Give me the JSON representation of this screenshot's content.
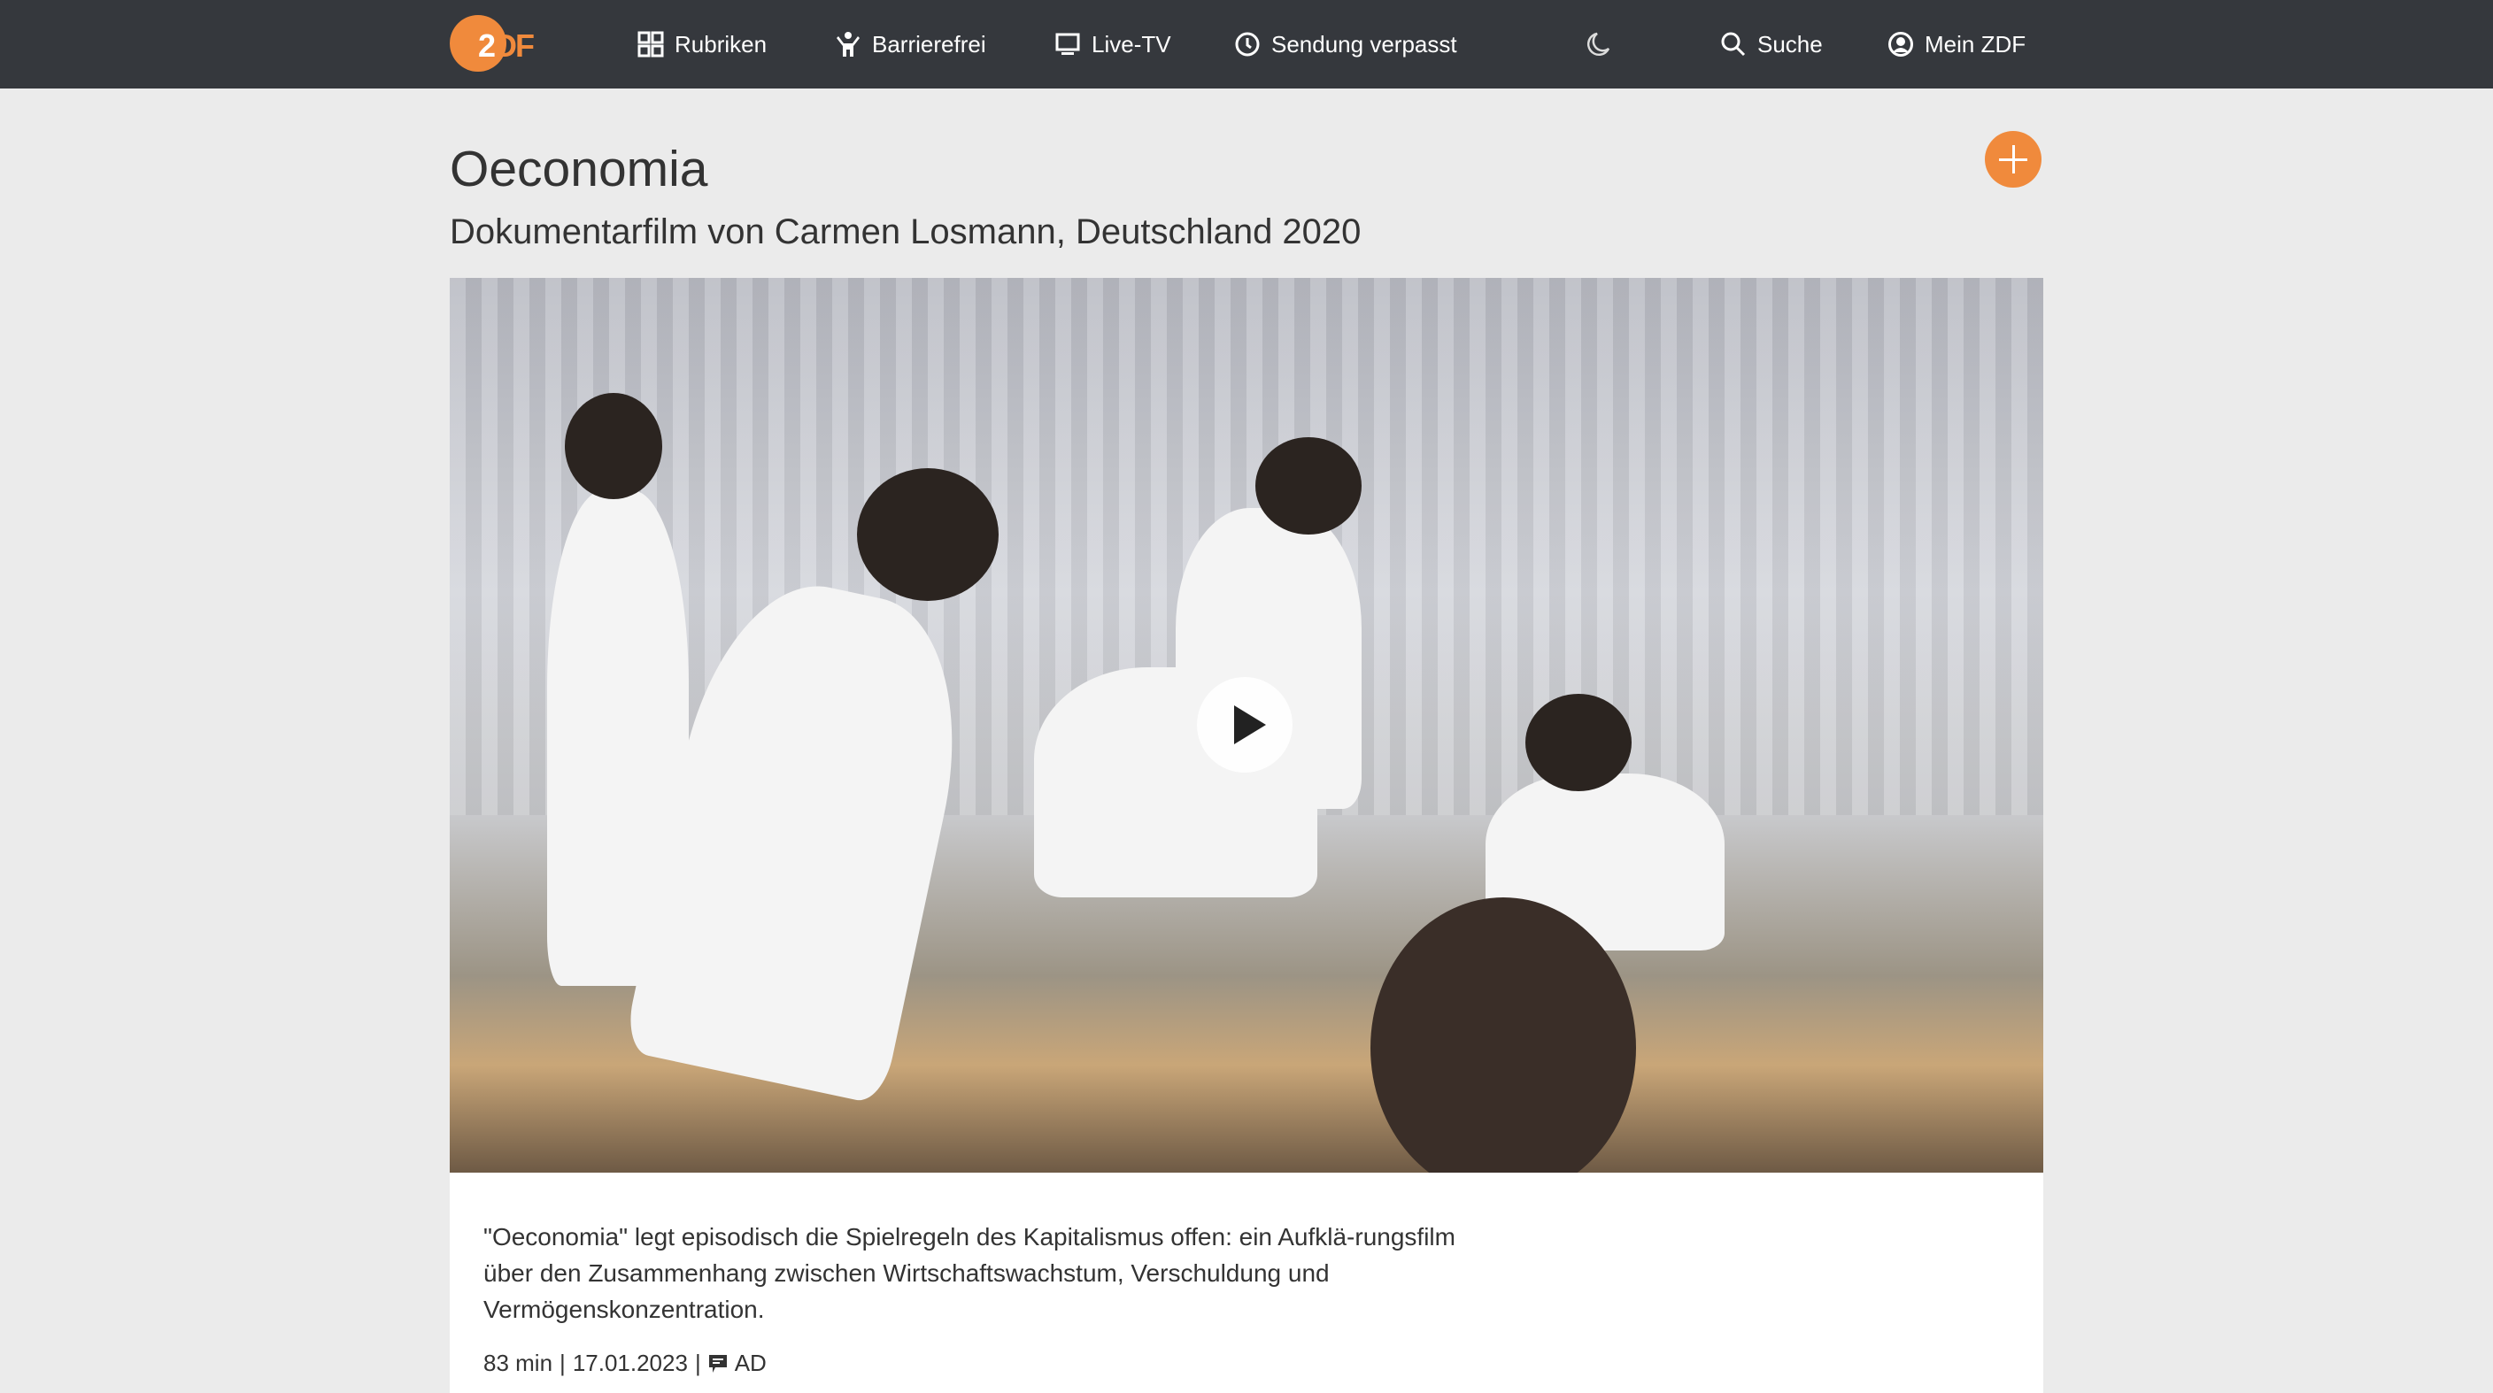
{
  "nav": {
    "logo": "ZDF",
    "items": [
      {
        "label": "Rubriken",
        "icon": "grid-icon"
      },
      {
        "label": "Barrierefrei",
        "icon": "accessibility-icon"
      },
      {
        "label": "Live-TV",
        "icon": "tv-icon"
      },
      {
        "label": "Sendung verpasst",
        "icon": "clock-icon"
      }
    ],
    "dark_mode_icon": "moon-icon",
    "search_label": "Suche",
    "account_label": "Mein ZDF"
  },
  "page": {
    "title": "Oeconomia",
    "subtitle": "Dokumentarfilm von Carmen Losmann, Deutschland 2020",
    "description": "\"Oeconomia\" legt episodisch die Spielregeln des Kapitalismus offen: ein Aufklä-rungsfilm über den Zusammenhang zwischen Wirtschaftswachstum, Verschuldung und Vermögenskonzentration.",
    "duration": "83 min",
    "separator": "|",
    "date": "17.01.2023",
    "ad_label": "AD"
  },
  "colors": {
    "nav_bg": "#35383d",
    "accent": "#f08a3c",
    "page_bg": "#ebebeb"
  }
}
